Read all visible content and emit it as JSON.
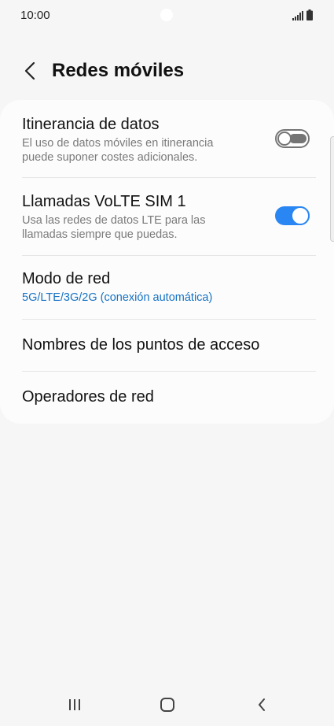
{
  "status_bar": {
    "time": "10:00",
    "icons": [
      "signal-icon",
      "battery-icon"
    ]
  },
  "header": {
    "back_icon": "back-arrow-icon",
    "title": "Redes móviles"
  },
  "settings": [
    {
      "title": "Itinerancia de datos",
      "subtitle_line1": "El uso de datos móviles en itinerancia",
      "subtitle_line2": "puede suponer costes adicionales.",
      "toggle": "off"
    },
    {
      "title": "Llamadas VoLTE SIM 1",
      "subtitle_line1": "Usa las redes de datos LTE para las",
      "subtitle_line2": "llamadas siempre que puedas.",
      "toggle": "on"
    },
    {
      "title": "Modo de red",
      "value": "5G/LTE/3G/2G (conexión automática)"
    },
    {
      "title": "Nombres de los puntos de acceso"
    },
    {
      "title": "Operadores de red"
    }
  ],
  "colors": {
    "accent": "#2a86f3",
    "value_text": "#1572c4",
    "background": "#f6f6f6",
    "card": "#fcfcfc"
  },
  "nav_bar": {
    "icons": [
      "recent-apps-icon",
      "home-icon",
      "back-icon"
    ]
  }
}
